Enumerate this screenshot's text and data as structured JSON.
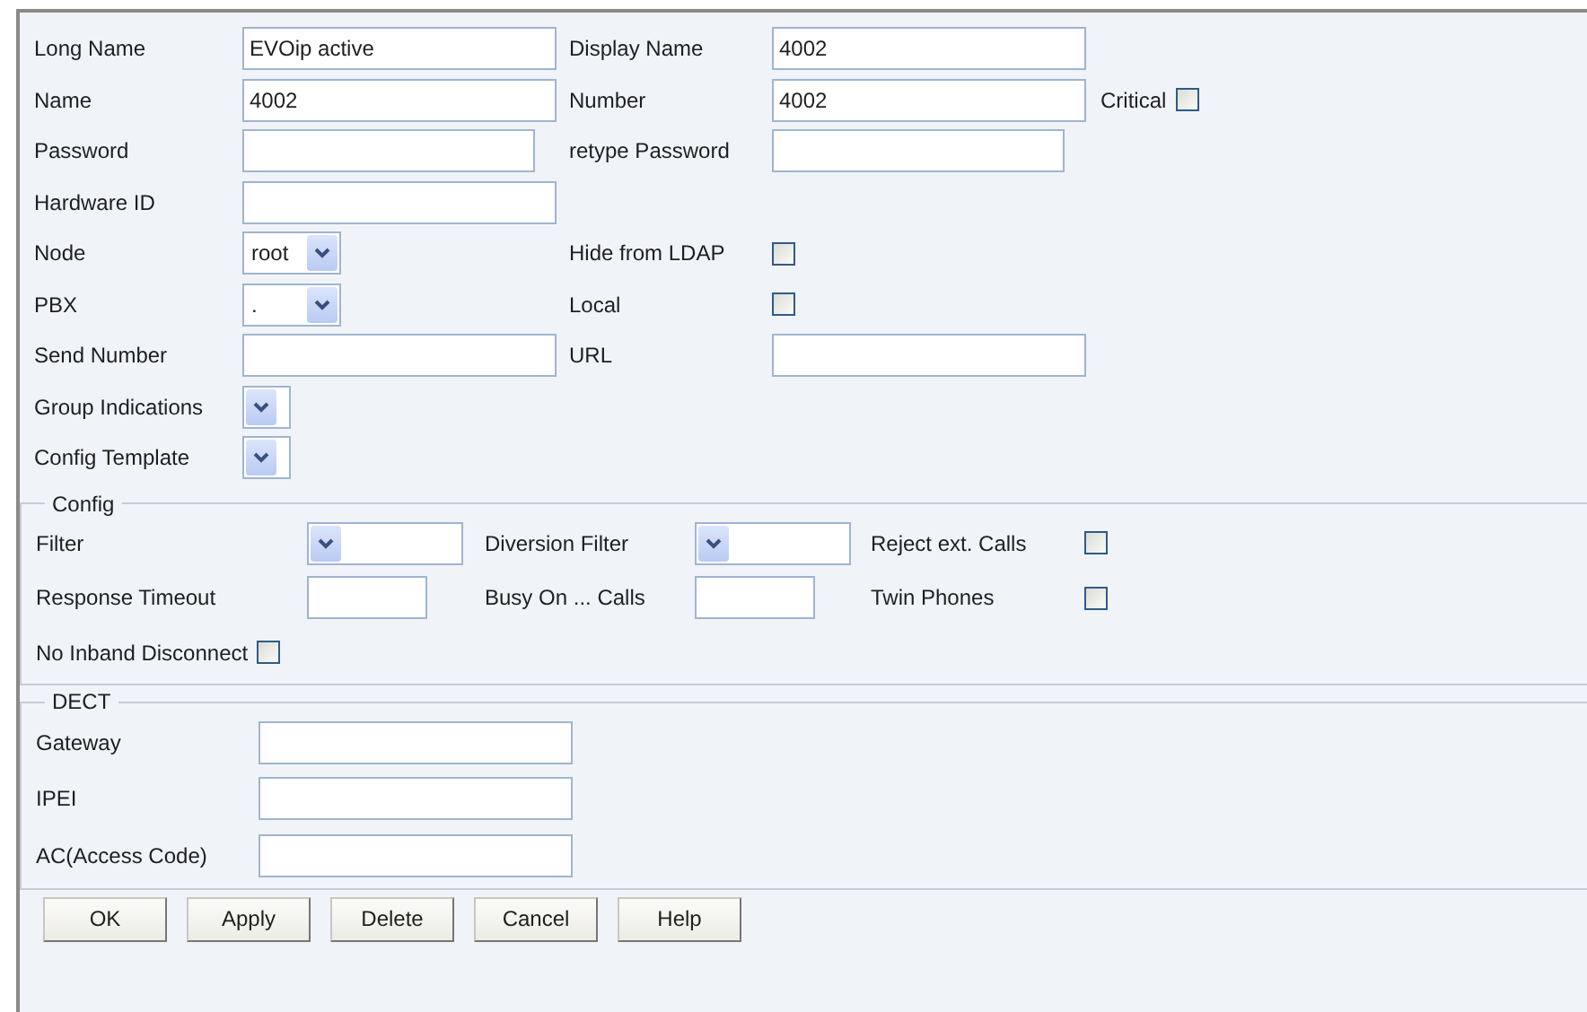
{
  "main": {
    "rows": [
      {
        "cells": [
          {
            "label": "Long Name",
            "kind": "text",
            "value": "EVOip active"
          },
          {
            "label": "Display Name",
            "kind": "text",
            "value": "4002"
          }
        ]
      },
      {
        "cells": [
          {
            "label": "Name",
            "kind": "text",
            "value": "4002"
          },
          {
            "label": "Number",
            "kind": "text",
            "value": "4002"
          },
          {
            "label": "Critical",
            "kind": "checkbox",
            "checked": false
          }
        ]
      },
      {
        "cells": [
          {
            "label": "Password",
            "kind": "password"
          },
          {
            "label": "retype Password",
            "kind": "password"
          }
        ]
      },
      {
        "cells": [
          {
            "label": "Hardware ID",
            "kind": "text"
          }
        ]
      },
      {
        "cells": [
          {
            "label": "Node",
            "kind": "select",
            "value": "root"
          },
          {
            "label": "Hide from LDAP",
            "kind": "checkbox",
            "checked": false
          }
        ]
      },
      {
        "cells": [
          {
            "label": "PBX",
            "kind": "select",
            "value": "."
          },
          {
            "label": "Local",
            "kind": "checkbox",
            "checked": false
          }
        ]
      },
      {
        "cells": [
          {
            "label": "Send Number",
            "kind": "text"
          },
          {
            "label": "URL",
            "kind": "text"
          }
        ]
      },
      {
        "cells": [
          {
            "label": "Group Indications",
            "kind": "select"
          }
        ]
      },
      {
        "cells": [
          {
            "label": "Config Template",
            "kind": "select"
          }
        ]
      }
    ]
  },
  "config": {
    "legend": "Config",
    "rows": [
      {
        "cells": [
          {
            "label": "Filter",
            "kind": "select"
          },
          {
            "label": "Diversion Filter",
            "kind": "select"
          },
          {
            "label": "Reject ext. Calls",
            "kind": "checkbox",
            "checked": false
          }
        ]
      },
      {
        "cells": [
          {
            "label": "Response Timeout",
            "kind": "text"
          },
          {
            "label": "Busy On ... Calls",
            "kind": "text"
          },
          {
            "label": "Twin Phones",
            "kind": "checkbox",
            "checked": false
          }
        ]
      },
      {
        "cells": [
          {
            "label": "No Inband Disconnect",
            "kind": "checkbox",
            "checked": false
          }
        ]
      }
    ]
  },
  "dect": {
    "legend": "DECT",
    "rows": [
      {
        "cells": [
          {
            "label": "Gateway",
            "kind": "text"
          }
        ]
      },
      {
        "cells": [
          {
            "label": "IPEI",
            "kind": "text"
          }
        ]
      },
      {
        "cells": [
          {
            "label": "AC(Access Code)",
            "kind": "text"
          }
        ]
      }
    ]
  },
  "buttons": [
    "OK",
    "Apply",
    "Delete",
    "Cancel",
    "Help"
  ]
}
